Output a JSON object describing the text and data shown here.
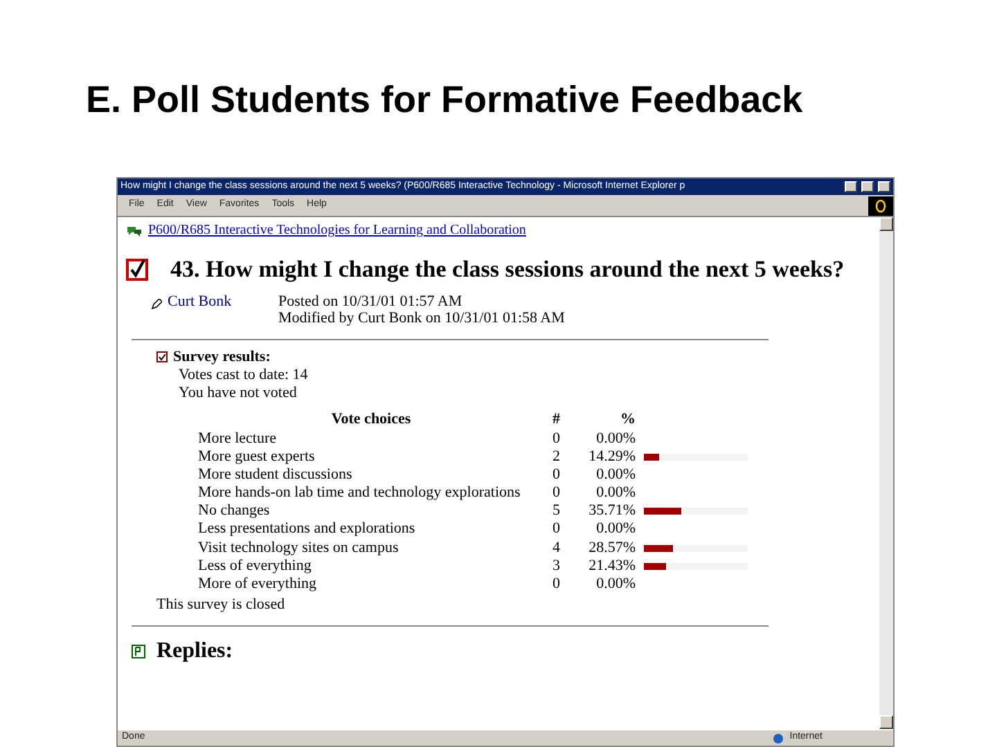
{
  "slide_title": "E. Poll Students for Formative Feedback",
  "window": {
    "title": "How might I change the class sessions around the next 5 weeks? (P600/R685 Interactive Technology - Microsoft Internet Explorer p"
  },
  "menu": [
    "File",
    "Edit",
    "View",
    "Favorites",
    "Tools",
    "Help"
  ],
  "breadcrumb": "P600/R685 Interactive Technologies for Learning and Collaboration",
  "question": "43. How might I change the class sessions around the next 5 weeks?",
  "author": "Curt Bonk",
  "posted": "Posted on 10/31/01 01:57 AM",
  "modified": "Modified by Curt Bonk on 10/31/01 01:58 AM",
  "survey": {
    "heading": "Survey results:",
    "votes_cast": "Votes cast to date: 14",
    "voted_status": "You have not voted",
    "columns": [
      "Vote choices",
      "#",
      "%"
    ],
    "rows": [
      {
        "choice": "More lecture",
        "count": "0",
        "percent": "0.00%"
      },
      {
        "choice": "More guest experts",
        "count": "2",
        "percent": "14.29%",
        "level": 0.1429
      },
      {
        "choice": "More student discussions",
        "count": "0",
        "percent": "0.00%"
      },
      {
        "choice": "More hands-on lab time and technology explorations",
        "count": "0",
        "percent": "0.00%"
      },
      {
        "choice": "No changes",
        "count": "5",
        "percent": "35.71%",
        "level": 0.3571
      },
      {
        "choice": "Less presentations and explorations",
        "count": "0",
        "percent": "0.00%"
      },
      {
        "choice": "Visit technology sites on campus",
        "count": "4",
        "percent": "28.57%",
        "level": 0.2857
      },
      {
        "choice": "Less of everything",
        "count": "3",
        "percent": "21.43%",
        "level": 0.2143
      },
      {
        "choice": "More of everything",
        "count": "0",
        "percent": "0.00%"
      }
    ],
    "closed_note": "This survey is closed"
  },
  "replies": "Replies:",
  "status_bar": {
    "left": "Done",
    "zone": "Internet"
  }
}
